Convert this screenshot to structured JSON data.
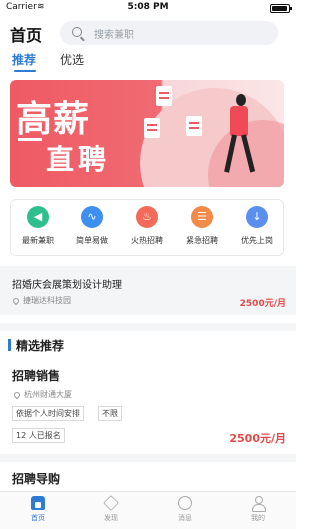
{
  "status_bar": {
    "carrier": "Carrier",
    "time": "5:08 PM"
  },
  "header": {
    "title": "首页",
    "search_placeholder": "搜索兼职"
  },
  "tabs": [
    {
      "label": "推荐",
      "active": true
    },
    {
      "label": "优选",
      "active": false
    }
  ],
  "banner": {
    "line1": "高薪",
    "line2": "直聘"
  },
  "quick_actions": [
    {
      "label": "最新兼职",
      "color": "#2fbf8f",
      "glyph": "◀"
    },
    {
      "label": "简单易做",
      "color": "#3d8ff0",
      "glyph": "∿"
    },
    {
      "label": "火热招聘",
      "color": "#f36a5a",
      "glyph": "♨"
    },
    {
      "label": "紧急招聘",
      "color": "#f28a4a",
      "glyph": "☰"
    },
    {
      "label": "优先上岗",
      "color": "#5a8ff0",
      "glyph": "↓"
    }
  ],
  "featured_job": {
    "title": "招婚庆会展策划设计助理",
    "location": "捷瑞达科技园",
    "salary": "2500元/月"
  },
  "section": {
    "title": "精选推荐"
  },
  "jobs": [
    {
      "name": "招聘销售",
      "location": "杭州财通大厦",
      "tags": [
        "依据个人时间安排",
        "不限",
        "12 人已报名"
      ],
      "salary": "2500元/月"
    },
    {
      "name": "招聘导购"
    }
  ],
  "bottom_nav": [
    {
      "label": "首页",
      "icon": "home-icon",
      "active": true
    },
    {
      "label": "发现",
      "icon": "diamond-icon",
      "active": false
    },
    {
      "label": "消息",
      "icon": "chat-icon",
      "active": false
    },
    {
      "label": "我的",
      "icon": "user-icon",
      "active": false
    }
  ]
}
